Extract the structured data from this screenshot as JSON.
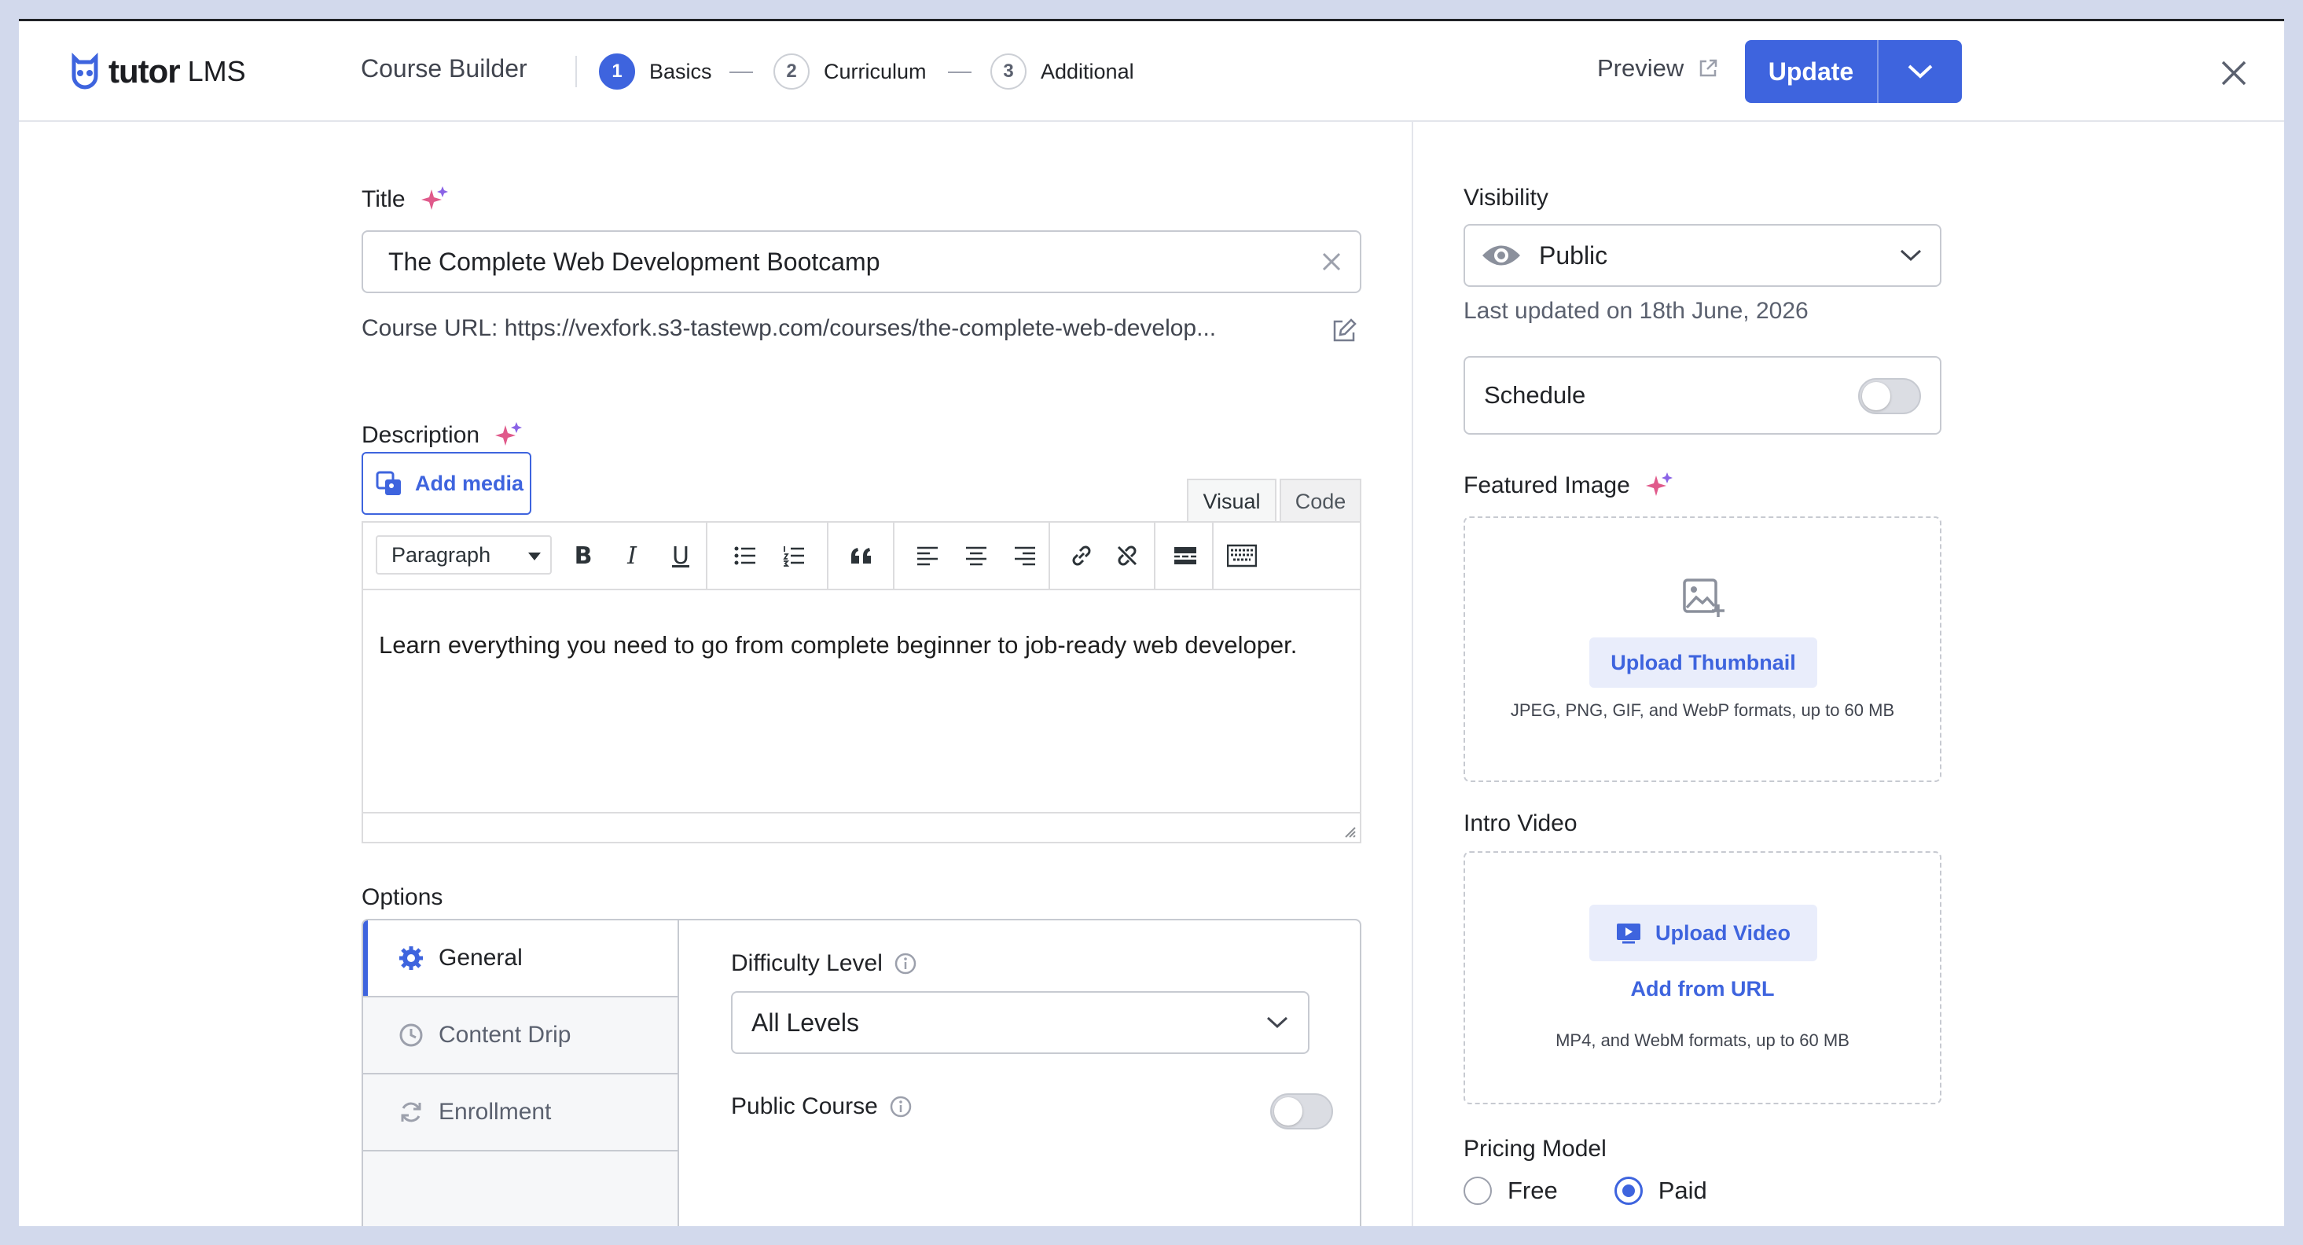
{
  "header": {
    "logo_text": "tutor",
    "logo_suffix": "LMS",
    "builder_title": "Course Builder",
    "steps": [
      {
        "num": "1",
        "label": "Basics",
        "active": true
      },
      {
        "num": "2",
        "label": "Curriculum",
        "active": false
      },
      {
        "num": "3",
        "label": "Additional",
        "active": false
      }
    ],
    "preview_label": "Preview",
    "update_label": "Update"
  },
  "basics": {
    "title_label": "Title",
    "title_value": "The Complete Web Development Bootcamp",
    "course_url": "Course URL: https://vexfork.s3-tastewp.com/courses/the-complete-web-develop...",
    "description_label": "Description",
    "add_media_label": "Add media",
    "editor_tabs": {
      "visual": "Visual",
      "code": "Code"
    },
    "format_select": "Paragraph",
    "description_text": "Learn everything you need to go from complete beginner to job-ready web developer."
  },
  "options": {
    "label": "Options",
    "nav": {
      "general": "General",
      "content_drip": "Content Drip",
      "enrollment": "Enrollment"
    },
    "difficulty_label": "Difficulty Level",
    "difficulty_value": "All Levels",
    "public_course_label": "Public Course",
    "public_course_enabled": false
  },
  "sidebar": {
    "visibility_label": "Visibility",
    "visibility_value": "Public",
    "last_updated": "Last updated on 18th June, 2026",
    "schedule_label": "Schedule",
    "schedule_enabled": false,
    "featured_image_label": "Featured Image",
    "upload_thumbnail_label": "Upload Thumbnail",
    "thumbnail_hint": "JPEG, PNG, GIF, and WebP formats, up to 60 MB",
    "intro_video_label": "Intro Video",
    "upload_video_label": "Upload Video",
    "add_from_url_label": "Add from URL",
    "video_hint": "MP4, and WebM formats, up to 60 MB",
    "pricing_label": "Pricing Model",
    "pricing_options": {
      "free": "Free",
      "paid": "Paid"
    },
    "pricing_selected": "Paid"
  },
  "colors": {
    "accent": "#3e64de",
    "backdrop": "#d2d9ec"
  }
}
